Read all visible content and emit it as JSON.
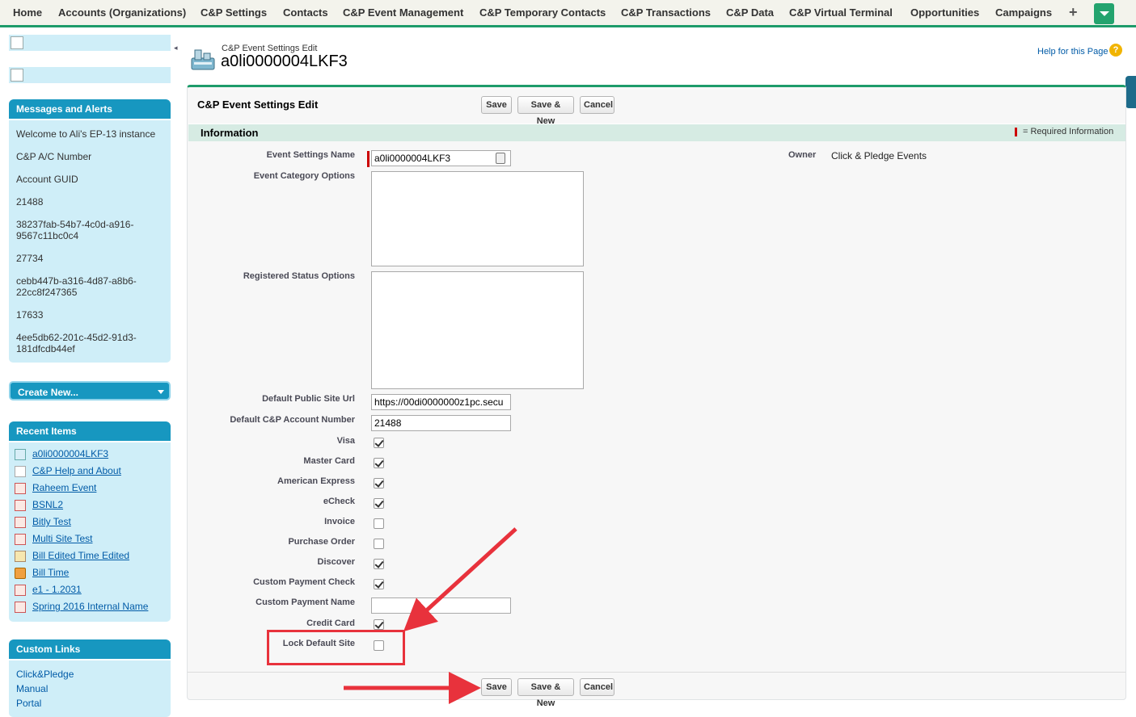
{
  "nav": {
    "tabs": [
      "Home",
      "Accounts (Organizations)",
      "C&P Settings",
      "Contacts",
      "C&P Event Management",
      "C&P Temporary Contacts",
      "C&P Transactions",
      "C&P Data",
      "C&P Virtual Terminal",
      "Opportunities",
      "Campaigns"
    ],
    "plus": "+"
  },
  "sidebar": {
    "messages_title": "Messages and Alerts",
    "messages": [
      "Welcome to Ali's EP-13 instance",
      "C&P A/C Number",
      "Account GUID",
      "21488",
      "38237fab-54b7-4c0d-a916-9567c11bc0c4",
      "27734",
      "cebb447b-a316-4d87-a8b6-22cc8f247365",
      "17633",
      "4ee5db62-201c-45d2-91d3-181dfcdb44ef"
    ],
    "create_new": "Create New...",
    "recent_title": "Recent Items",
    "recent": [
      {
        "label": "a0li0000004LKF3",
        "icon": "event-settings-icon"
      },
      {
        "label": "C&P Help and About",
        "icon": "document-icon"
      },
      {
        "label": "Raheem Event",
        "icon": "text-document-icon"
      },
      {
        "label": "BSNL2",
        "icon": "text-document-icon"
      },
      {
        "label": "Bitly Test",
        "icon": "text-document-icon"
      },
      {
        "label": "Multi Site Test",
        "icon": "text-document-icon"
      },
      {
        "label": "Bill Edited Time Edited",
        "icon": "bill-icon"
      },
      {
        "label": "Bill Time",
        "icon": "time-icon"
      },
      {
        "label": "e1 - 1.2031",
        "icon": "text-document-icon"
      },
      {
        "label": "Spring 2016 Internal Name",
        "icon": "text-document-icon"
      }
    ],
    "custom_links_title": "Custom Links",
    "custom_links": [
      "Click&Pledge",
      "Manual",
      "Portal"
    ]
  },
  "header": {
    "breadcrumb": "C&P Event Settings Edit",
    "record_name": "a0li0000004LKF3",
    "help": "Help for this Page",
    "help_icon": "?"
  },
  "edit": {
    "title": "C&P Event Settings Edit",
    "save": "Save",
    "save_new": "Save & New",
    "cancel": "Cancel",
    "section_title": "Information",
    "required_legend": "= Required Information",
    "fields": {
      "event_settings_name": {
        "label": "Event Settings Name",
        "value": "a0li0000004LKF3"
      },
      "event_category_options": {
        "label": "Event Category Options",
        "value": ""
      },
      "registered_status_options": {
        "label": "Registered Status Options",
        "value": ""
      },
      "default_public_site_url": {
        "label": "Default Public Site Url",
        "value": "https://00di0000000z1pc.secu"
      },
      "default_account_number": {
        "label": "Default C&P Account Number",
        "value": "21488"
      },
      "custom_payment_name": {
        "label": "Custom Payment Name",
        "value": ""
      }
    },
    "checkboxes": [
      {
        "label": "Visa",
        "checked": true
      },
      {
        "label": "Master Card",
        "checked": true
      },
      {
        "label": "American Express",
        "checked": true
      },
      {
        "label": "eCheck",
        "checked": true
      },
      {
        "label": "Invoice",
        "checked": false
      },
      {
        "label": "Purchase Order",
        "checked": false
      },
      {
        "label": "Discover",
        "checked": true
      },
      {
        "label": "Custom Payment Check",
        "checked": true
      },
      {
        "label": "Credit Card",
        "checked": true
      },
      {
        "label": "Lock Default Site",
        "checked": false
      }
    ],
    "owner_label": "Owner",
    "owner_value": "Click & Pledge Events"
  },
  "annotation_color": "#e8323c",
  "accent_color": "#1d9b6a"
}
